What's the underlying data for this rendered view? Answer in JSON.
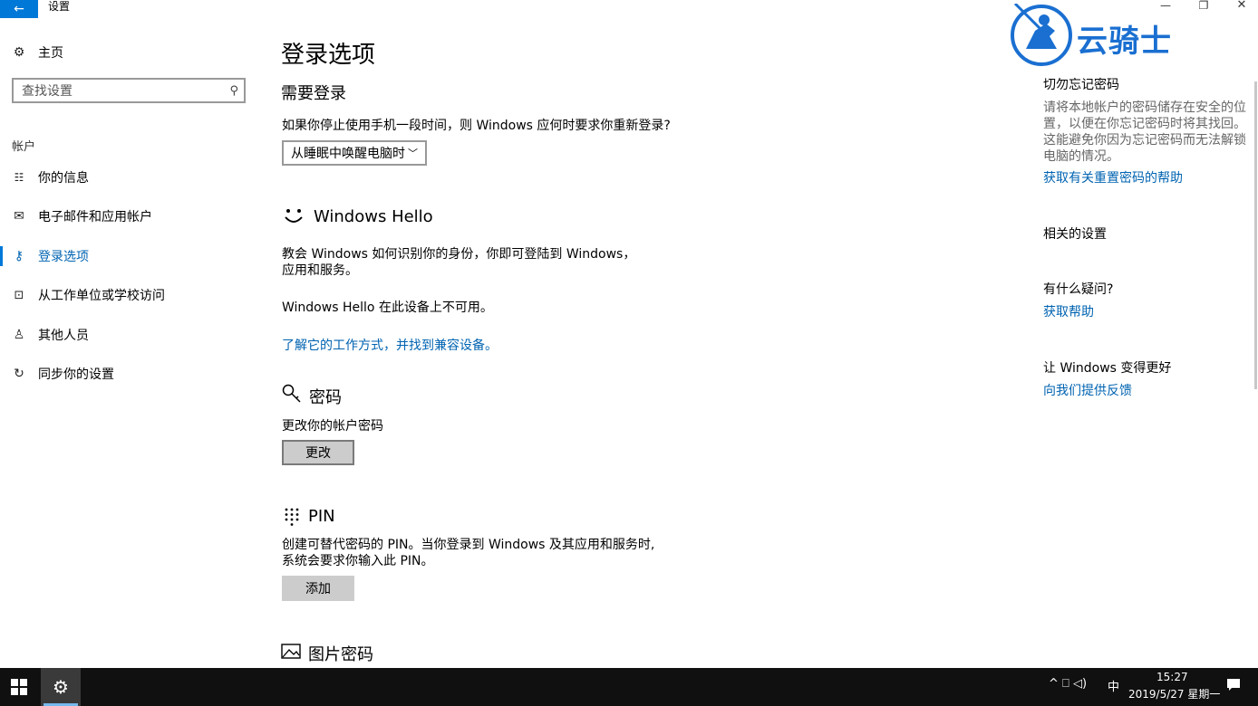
{
  "window": {
    "title": "设置",
    "back_glyph": "←",
    "minimize_glyph": "—",
    "restore_glyph": "❐",
    "close_glyph": "✕"
  },
  "watermark": {
    "text": "云骑士"
  },
  "sidebar": {
    "home_label": "主页",
    "search_placeholder": "查找设置",
    "section_label": "帐户",
    "items": [
      {
        "label": "你的信息",
        "icon": "person-card-icon",
        "active": false
      },
      {
        "label": "电子邮件和应用帐户",
        "icon": "mail-icon",
        "active": false
      },
      {
        "label": "登录选项",
        "icon": "key-icon",
        "active": true
      },
      {
        "label": "从工作单位或学校访问",
        "icon": "briefcase-icon",
        "active": false
      },
      {
        "label": "其他人员",
        "icon": "person-add-icon",
        "active": false
      },
      {
        "label": "同步你的设置",
        "icon": "sync-icon",
        "active": false
      }
    ]
  },
  "main": {
    "title": "登录选项",
    "require_signin": {
      "heading": "需要登录",
      "question": "如果你停止使用手机一段时间，则 Windows 应何时要求你重新登录?",
      "dropdown_value": "从睡眠中唤醒电脑时"
    },
    "hello": {
      "heading": "Windows Hello",
      "desc": "教会 Windows 如何识别你的身份，你即可登陆到 Windows，应用和服务。",
      "unavailable": "Windows Hello 在此设备上不可用。",
      "link": "了解它的工作方式，并找到兼容设备。"
    },
    "password": {
      "heading": "密码",
      "desc": "更改你的帐户密码",
      "button": "更改"
    },
    "pin": {
      "heading": "PIN",
      "desc_line1": "创建可替代密码的 PIN。当你登录到 Windows 及其应用和服务时,",
      "desc_line2": "系统会要求你输入此 PIN。",
      "button": "添加"
    },
    "picture_password": {
      "heading": "图片密码"
    }
  },
  "right_panel": {
    "forgot_heading": "切勿忘记密码",
    "forgot_lines": [
      "请将本地帐户的密码储存在安全的位",
      "置，以便在你忘记密码时将其找回。",
      "这能避免你因为忘记密码而无法解锁",
      "电脑的情况。"
    ],
    "forgot_link": "获取有关重置密码的帮助",
    "related_heading": "相关的设置",
    "question_heading": "有什么疑问?",
    "help_link": "获取帮助",
    "improve_heading": "让 Windows 变得更好",
    "feedback_link": "向我们提供反馈"
  },
  "taskbar": {
    "time": "15:27",
    "date": "2019/5/27 星期一",
    "ime": "中",
    "tray_glyphs": "^  ⎕  ◁)"
  },
  "colors": {
    "accent": "#0078d7",
    "link": "#0063b1",
    "taskbar": "#101010"
  }
}
